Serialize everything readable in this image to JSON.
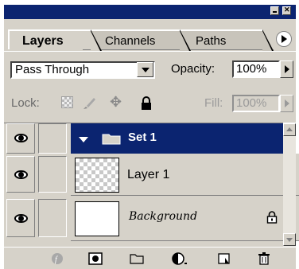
{
  "panel": {
    "tabs": [
      {
        "label": "Layers",
        "active": true
      },
      {
        "label": "Channels",
        "active": false
      },
      {
        "label": "Paths",
        "active": false
      }
    ]
  },
  "options": {
    "blend_mode": "Pass Through",
    "opacity_label": "Opacity:",
    "opacity_value": "100%"
  },
  "lock": {
    "label": "Lock:",
    "fill_label": "Fill:",
    "fill_value": "100%"
  },
  "layers": [
    {
      "name": "Set 1",
      "type": "set",
      "visible": true,
      "selected": true
    },
    {
      "name": "Layer 1",
      "type": "layer",
      "visible": true,
      "selected": false
    },
    {
      "name": "Background",
      "type": "background",
      "visible": true,
      "locked": true
    }
  ],
  "bottom_icons": [
    "layer-style-icon",
    "mask-icon",
    "new-set-icon",
    "adjustment-layer-icon",
    "new-layer-icon",
    "trash-icon"
  ],
  "colors": {
    "panel_bg": "#d6d2c9",
    "selection": "#0b2470"
  }
}
